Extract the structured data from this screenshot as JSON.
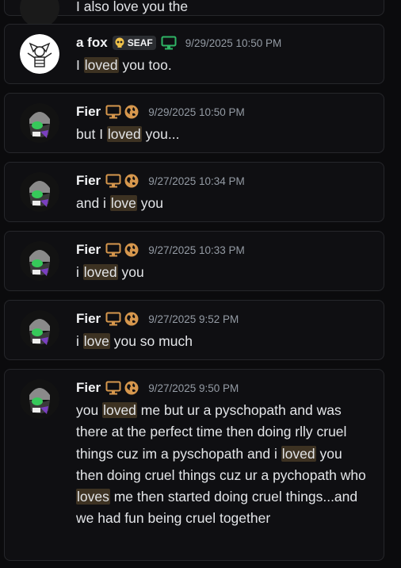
{
  "top_partial": {
    "text": "I also love you the"
  },
  "colors": {
    "highlight_bg": "#3d3222",
    "monitor_orange": "#d6974d",
    "monitor_green": "#2fb565",
    "globe_orange": "#d6974d"
  },
  "messages": [
    {
      "author": "a fox",
      "avatar": "fox-sketch",
      "tag": "SEAF",
      "tag_icon": "skull-emoji",
      "badges": [
        "monitor-icon-green"
      ],
      "timestamp": "9/29/2025 10:50 PM",
      "segments": [
        {
          "t": "I ",
          "h": false
        },
        {
          "t": "loved",
          "h": true
        },
        {
          "t": " you too.",
          "h": false
        }
      ]
    },
    {
      "author": "Fier",
      "avatar": "cat-hood",
      "badges": [
        "monitor-icon-orange",
        "globe-icon"
      ],
      "timestamp": "9/29/2025 10:50 PM",
      "segments": [
        {
          "t": "but I ",
          "h": false
        },
        {
          "t": "loved",
          "h": true
        },
        {
          "t": " you...",
          "h": false
        }
      ]
    },
    {
      "author": "Fier",
      "avatar": "cat-hood",
      "badges": [
        "monitor-icon-orange",
        "globe-icon"
      ],
      "timestamp": "9/27/2025 10:34 PM",
      "segments": [
        {
          "t": "and i ",
          "h": false
        },
        {
          "t": "love",
          "h": true
        },
        {
          "t": " you",
          "h": false
        }
      ]
    },
    {
      "author": "Fier",
      "avatar": "cat-hood",
      "badges": [
        "monitor-icon-orange",
        "globe-icon"
      ],
      "timestamp": "9/27/2025 10:33 PM",
      "segments": [
        {
          "t": "i ",
          "h": false
        },
        {
          "t": "loved",
          "h": true
        },
        {
          "t": " you",
          "h": false
        }
      ]
    },
    {
      "author": "Fier",
      "avatar": "cat-hood",
      "badges": [
        "monitor-icon-orange",
        "globe-icon"
      ],
      "timestamp": "9/27/2025 9:52 PM",
      "segments": [
        {
          "t": "i ",
          "h": false
        },
        {
          "t": "love",
          "h": true
        },
        {
          "t": " you so much",
          "h": false
        }
      ]
    },
    {
      "author": "Fier",
      "avatar": "cat-hood",
      "badges": [
        "monitor-icon-orange",
        "globe-icon"
      ],
      "timestamp": "9/27/2025 9:50 PM",
      "segments": [
        {
          "t": "you ",
          "h": false
        },
        {
          "t": "loved",
          "h": true
        },
        {
          "t": " me but ur a pyschopath and was there at the perfect time then doing rlly cruel things cuz im a pyschopath and i ",
          "h": false
        },
        {
          "t": "loved",
          "h": true
        },
        {
          "t": " you then doing cruel things cuz ur a pychopath who ",
          "h": false
        },
        {
          "t": "loves",
          "h": true
        },
        {
          "t": " me then started doing cruel things...and we had fun being cruel together",
          "h": false
        }
      ]
    }
  ]
}
